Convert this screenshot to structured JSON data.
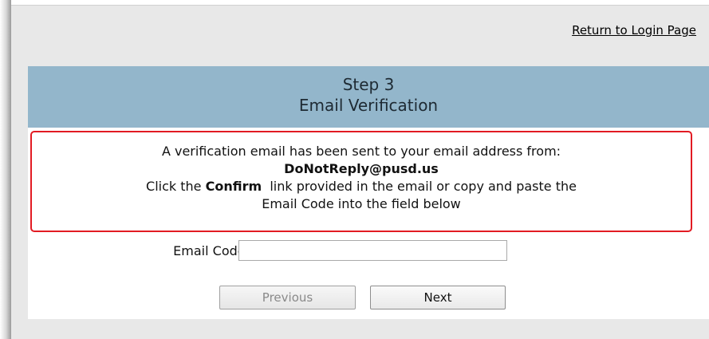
{
  "header_link": {
    "return_label": "Return to Login Page"
  },
  "step": {
    "step_label": "Step 3",
    "title": "Email Verification"
  },
  "notice": {
    "line1": "A verification email has been sent to your email address from:",
    "sender_email": "DoNotReply@pusd.us",
    "line3_prefix": "Click the ",
    "line3_bold": "Confirm",
    "line3_suffix": "  link provided in the email or copy and paste the",
    "line4": "Email Code into the field below",
    "border_color": "#e21b23"
  },
  "form": {
    "email_code_label": "Email Code:",
    "email_code_value": ""
  },
  "buttons": {
    "previous_label": "Previous",
    "next_label": "Next"
  },
  "colors": {
    "header_band": "#93b6cb",
    "page_background": "#e8e8e8"
  }
}
